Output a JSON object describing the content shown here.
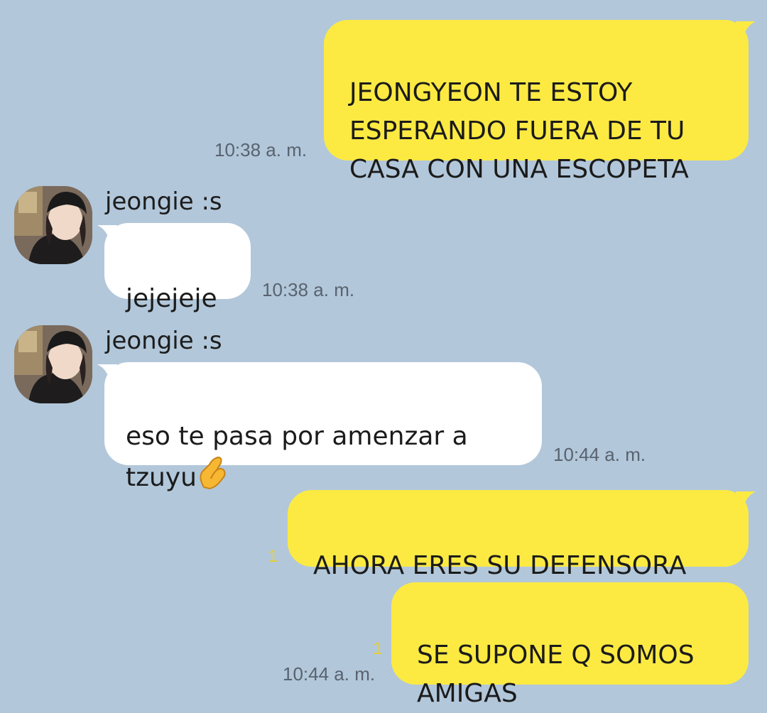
{
  "messages": [
    {
      "direction": "out",
      "text": "JEONGYEON TE ESTOY\nESPERANDO FUERA DE TU\nCASA CON UNA ESCOPETA",
      "time": "10:38 a. m."
    },
    {
      "direction": "in",
      "sender": "jeongie :s",
      "text": "jejejeje",
      "time": "10:38 a. m."
    },
    {
      "direction": "in",
      "sender": "jeongie :s",
      "text": "eso te pasa por amenzar a\ntzuyu",
      "emoji": "pinched-fingers-emoji",
      "time": "10:44 a. m."
    },
    {
      "direction": "out",
      "text": "AHORA ERES SU DEFENSORA",
      "unread": "1"
    },
    {
      "direction": "out",
      "text": "SE SUPONE Q SOMOS\nAMIGAS",
      "unread": "1",
      "time": "10:44 a. m."
    }
  ],
  "colors": {
    "background": "#b2c7da",
    "outgoing_bubble": "#fcea42",
    "incoming_bubble": "#ffffff",
    "unread_count": "#e8d02c",
    "timestamp": "#59636f"
  }
}
